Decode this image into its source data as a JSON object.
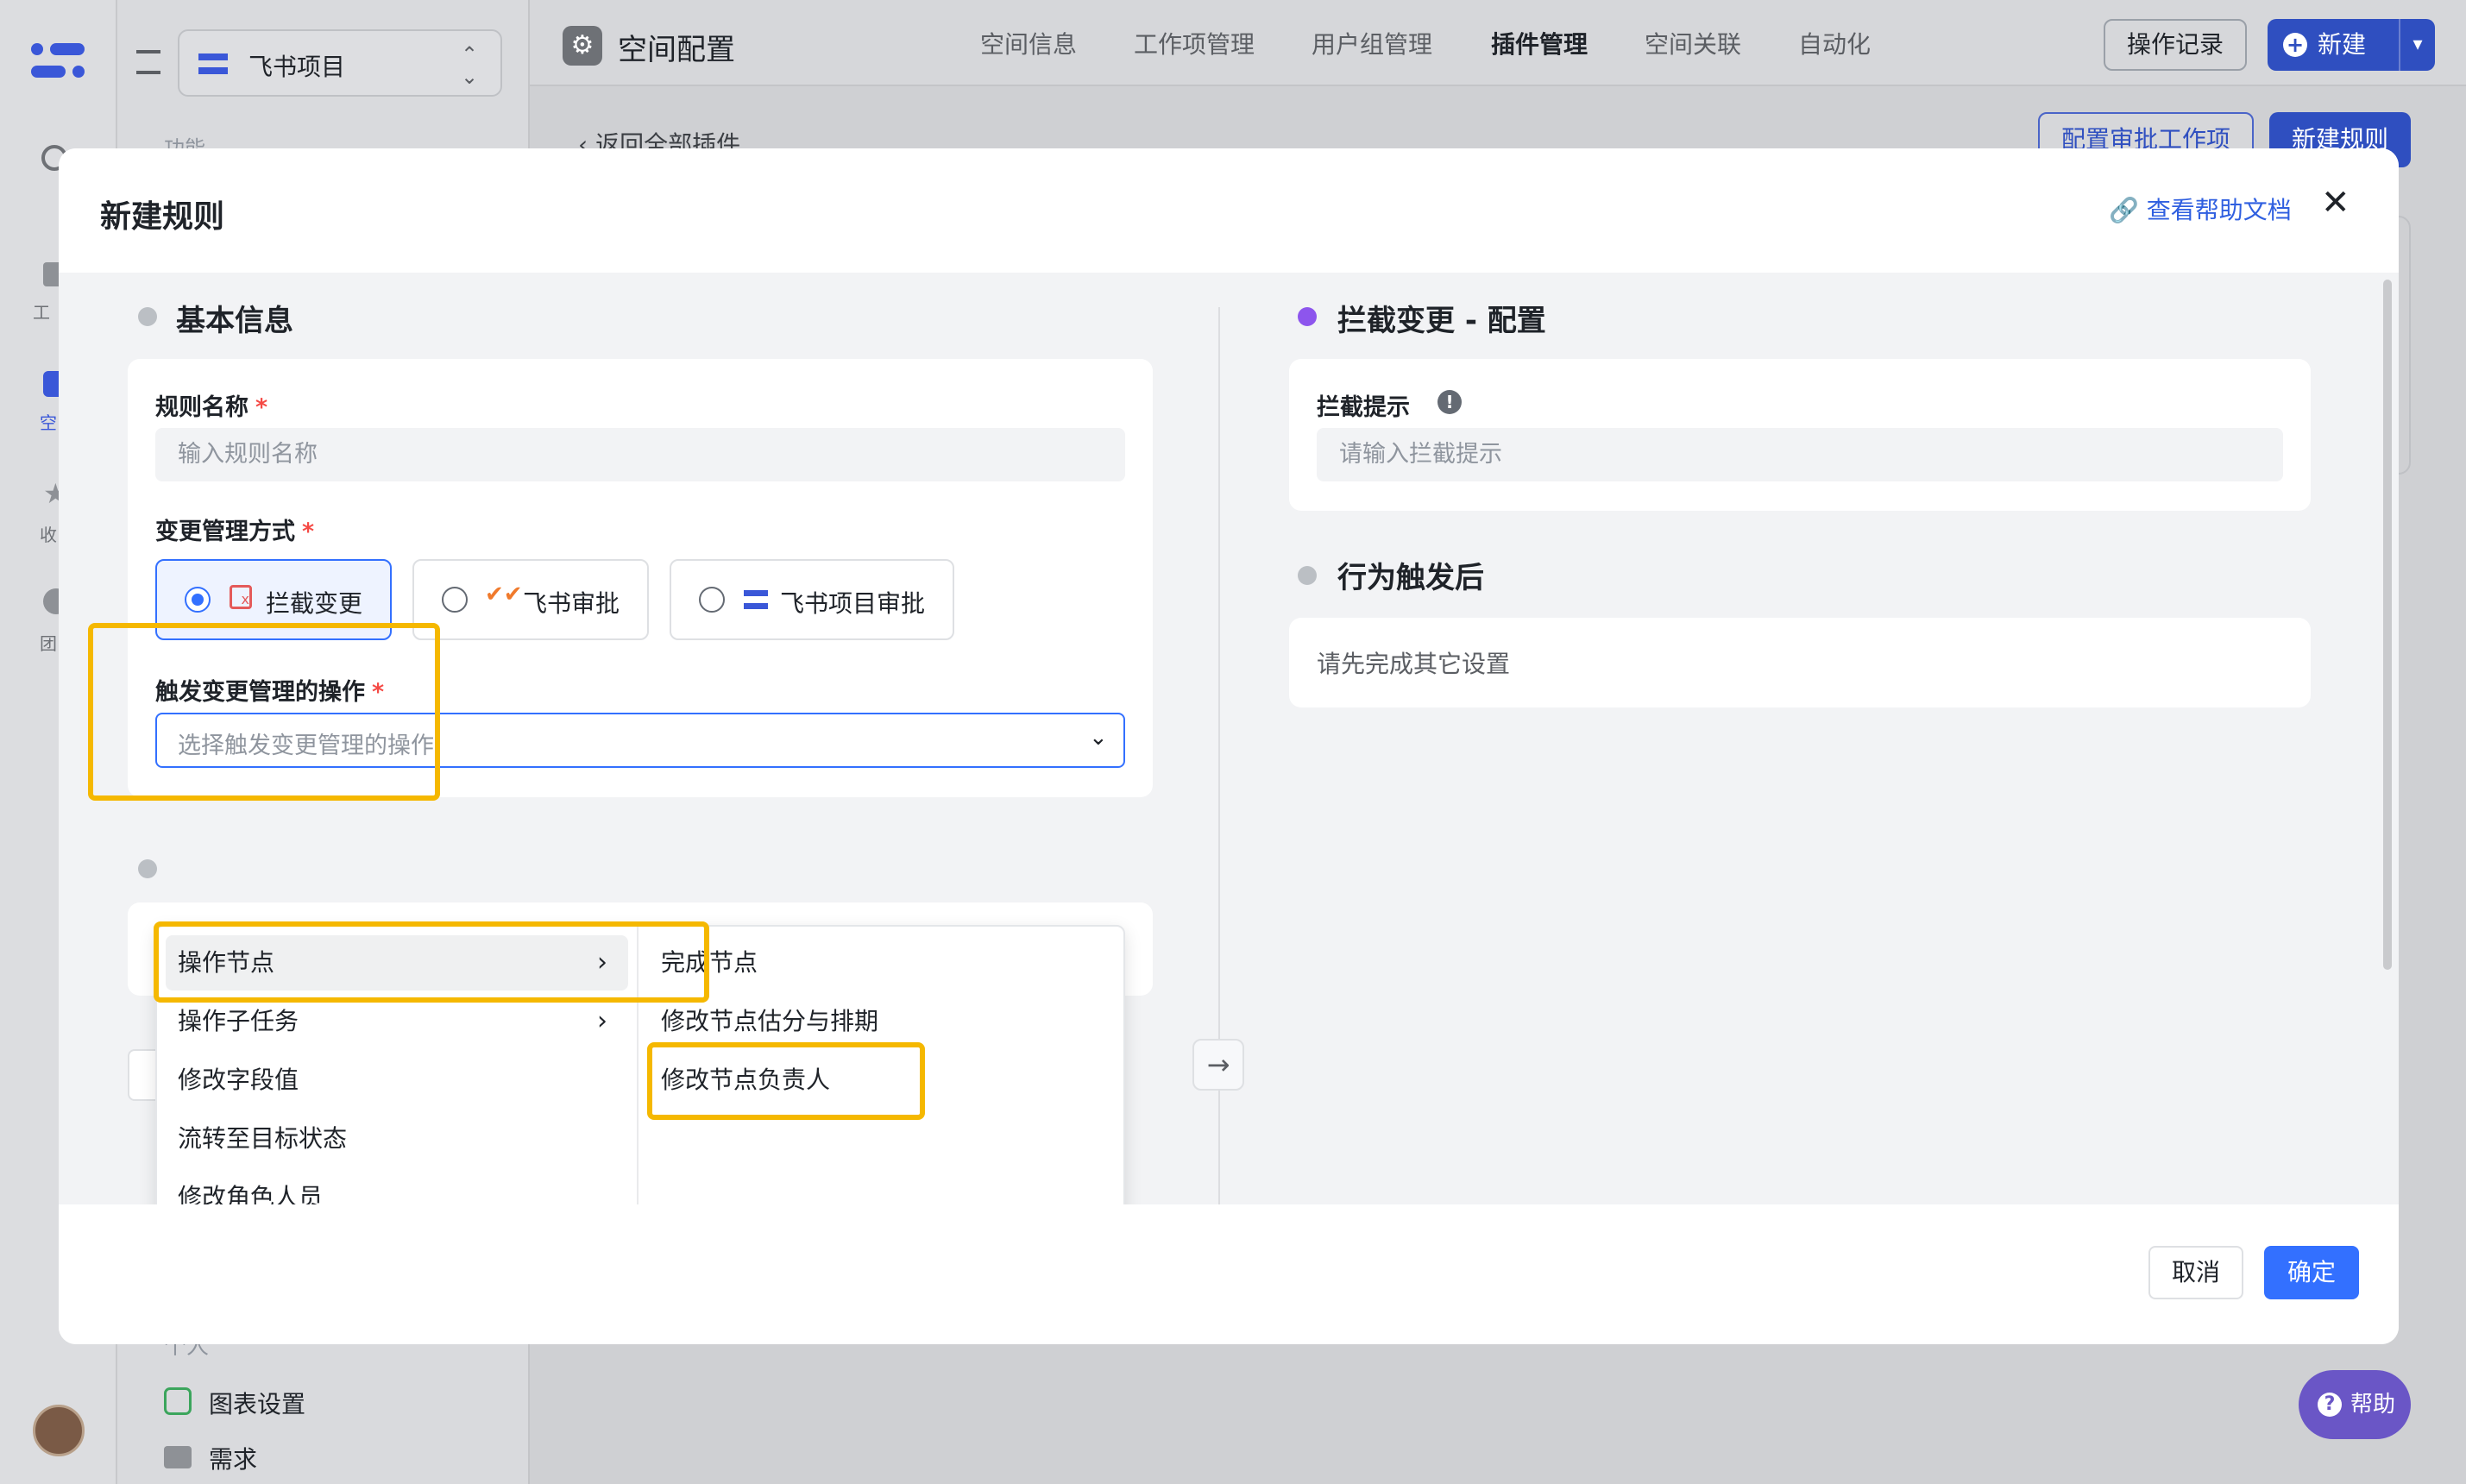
{
  "app": {
    "project_name": "飞书项目",
    "page_title": "空间配置",
    "sidebar_section_label": "功能",
    "sidebar_personal_label": "个人",
    "sidebar_items": [
      {
        "label": "图表设置",
        "icon": "chart-settings-icon"
      },
      {
        "label": "需求",
        "icon": "folder-icon"
      }
    ],
    "rail_labels": [
      "工",
      "空",
      "收",
      "团"
    ]
  },
  "top_tabs": [
    {
      "label": "空间信息",
      "active": false
    },
    {
      "label": "工作项管理",
      "active": false
    },
    {
      "label": "用户组管理",
      "active": false
    },
    {
      "label": "插件管理",
      "active": true
    },
    {
      "label": "空间关联",
      "active": false
    },
    {
      "label": "自动化",
      "active": false
    }
  ],
  "top_actions": {
    "history": "操作记录",
    "create": "新建"
  },
  "background": {
    "back_link": "返回全部插件",
    "config_approval": "配置审批工作项",
    "new_rule": "新建规则"
  },
  "modal": {
    "title": "新建规则",
    "help_link": "查看帮助文档",
    "basic_info": {
      "title": "基本信息",
      "rule_name_label": "规则名称",
      "rule_name_placeholder": "输入规则名称",
      "change_mode_label": "变更管理方式",
      "options": [
        {
          "label": "拦截变更",
          "selected": true,
          "icon": "intercept-icon"
        },
        {
          "label": "飞书审批",
          "selected": false,
          "icon": "feishu-approval-icon"
        },
        {
          "label": "飞书项目审批",
          "selected": false,
          "icon": "feishu-project-icon"
        }
      ],
      "trigger_label": "触发变更管理的操作",
      "trigger_placeholder": "选择触发变更管理的操作"
    },
    "dropdown": {
      "primary": [
        {
          "label": "操作节点",
          "has_children": true
        },
        {
          "label": "操作子任务",
          "has_children": true
        },
        {
          "label": "修改字段值",
          "has_children": false
        },
        {
          "label": "流转至目标状态",
          "has_children": false
        },
        {
          "label": "修改角色人员",
          "has_children": false
        }
      ],
      "secondary": [
        "完成节点",
        "修改节点估分与排期",
        "修改节点负责人"
      ]
    },
    "intercept_config": {
      "title": "拦截变更 - 配置",
      "prompt_label": "拦截提示",
      "prompt_placeholder": "请输入拦截提示"
    },
    "after_trigger": {
      "title": "行为触发后",
      "placeholder": "请先完成其它设置"
    },
    "footer": {
      "cancel": "取消",
      "confirm": "确定"
    }
  },
  "help_button": "帮助",
  "colors": {
    "primary": "#3370ff",
    "highlight": "#f5b800",
    "required": "#f54a45",
    "purple_dot": "#8d55ed"
  }
}
